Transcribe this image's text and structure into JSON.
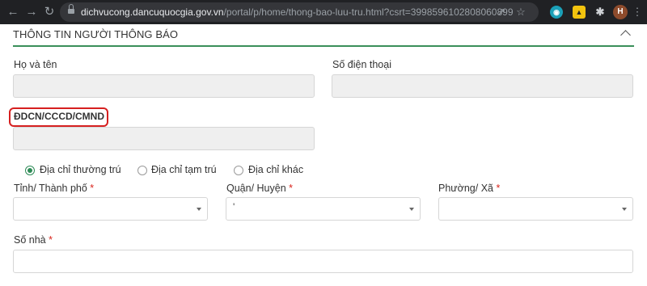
{
  "browser": {
    "url_host": "dichvucong.dancuquocgia.gov.vn",
    "url_path": "/portal/p/home/thong-bao-luu-tru.html?csrt=3998596102808060899",
    "profile_initial": "H",
    "icons": [
      "back-icon",
      "forward-icon",
      "reload-icon",
      "lock-icon",
      "share-icon",
      "star-icon",
      "extensions-icon"
    ]
  },
  "section": {
    "title": "THÔNG TIN NGƯỜI THÔNG BÁO"
  },
  "form": {
    "full_name_label": "Họ và tên",
    "phone_label": "Số điện thoại",
    "id_label": "ĐDCN/CCCD/CMND",
    "address_options": [
      "Địa chỉ thường trú",
      "Địa chỉ tạm trú",
      "Địa chỉ khác"
    ],
    "selected_address": "Địa chỉ thường trú",
    "province_label": "Tỉnh/ Thành phố",
    "district_label": "Quận/ Huyện",
    "ward_label": "Phường/ Xã",
    "house_label": "Số nhà",
    "required_mark": "*",
    "district_value": "'"
  },
  "colors": {
    "accent_green": "#2e8b57",
    "required_red": "#d9251c",
    "highlight_red": "#d62020"
  }
}
